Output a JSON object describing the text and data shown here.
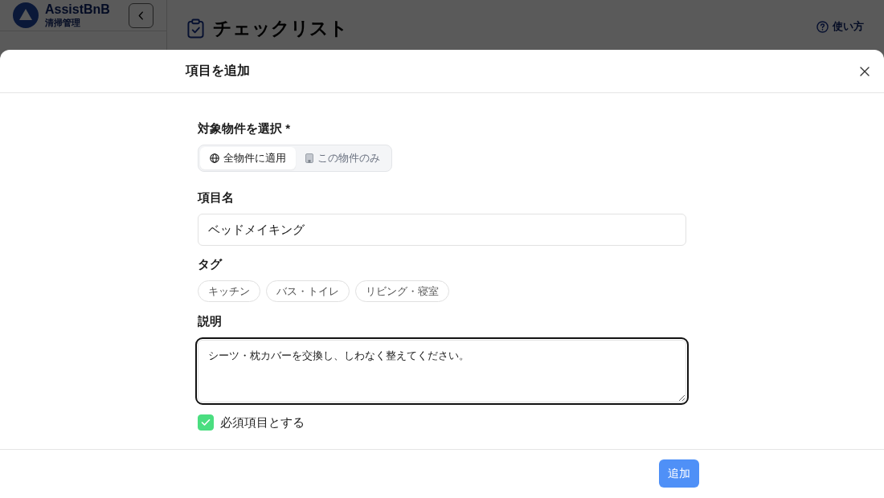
{
  "app": {
    "sidebar": {
      "brand": "AssistBnB",
      "subtitle": "清掃管理"
    },
    "header": {
      "title": "チェックリスト",
      "help_link": "使い方"
    }
  },
  "modal": {
    "title": "項目を追加",
    "scope": {
      "label": "対象物件を選択 *",
      "options": [
        {
          "label": "全物件に適用",
          "selected": true
        },
        {
          "label": "この物件のみ",
          "selected": false
        }
      ]
    },
    "item_name": {
      "label": "項目名",
      "value": "ベッドメイキング"
    },
    "tags": {
      "label": "タグ",
      "items": [
        {
          "label": "キッチン",
          "selected": false
        },
        {
          "label": "バス・トイレ",
          "selected": false
        },
        {
          "label": "リビング・寝室",
          "selected": false
        }
      ]
    },
    "description": {
      "label": "説明",
      "value": "シーツ・枕カバーを交換し、しわなく整えてください。",
      "focused": true
    },
    "required": {
      "label": "必須項目とする",
      "checked": true
    },
    "submit_button": "追加"
  }
}
